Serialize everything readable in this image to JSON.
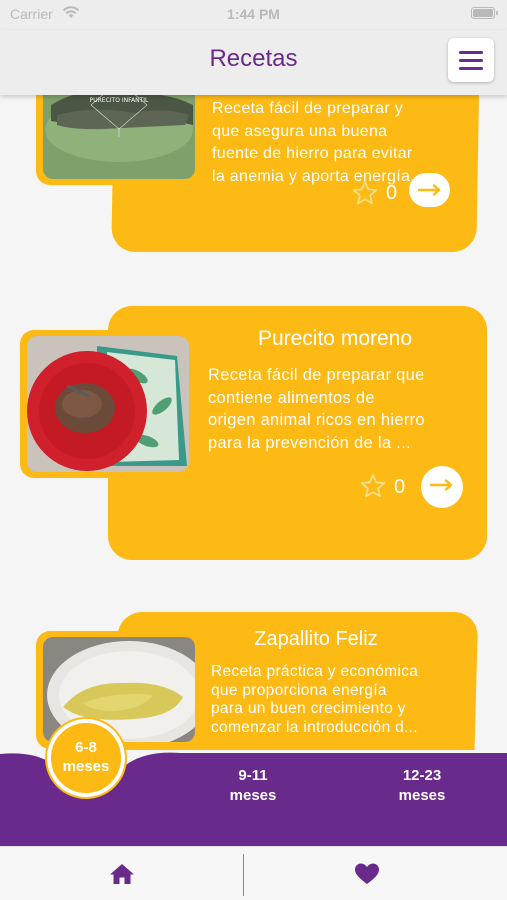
{
  "status_bar": {
    "carrier": "Carrier",
    "time": "1:44 PM",
    "icons": [
      "wifi-icon",
      "battery-icon"
    ]
  },
  "header": {
    "title": "Recetas",
    "menu_icon": "hamburger-menu-icon"
  },
  "recipes": [
    {
      "title": "",
      "description_lines": [
        "Receta fácil de preparar y",
        "que asegura una buena",
        "fuente de hierro para evitar",
        "la anemia  y aporta energía..."
      ],
      "likes": "0",
      "photo_icon": "green-puree-photo",
      "photo_watermark": "PURECITO INFANTIL"
    },
    {
      "title": "Purecito moreno",
      "description_lines": [
        "Receta fácil de preparar que",
        "contiene alimentos de",
        "origen animal ricos en hierro",
        "para la prevención de la ..."
      ],
      "likes": "0",
      "photo_icon": "brown-puree-red-plate-photo"
    },
    {
      "title": "Zapallito Feliz",
      "description_lines": [
        "Receta práctica y económica",
        "que proporciona energía",
        "para un buen crecimiento y",
        "comenzar la introducción d..."
      ],
      "likes": "0",
      "photo_icon": "squash-puree-plate-photo"
    }
  ],
  "age_tabs": [
    {
      "line1": "6-8",
      "line2": "meses",
      "selected": true
    },
    {
      "line1": "9-11",
      "line2": "meses",
      "selected": false
    },
    {
      "line1": "12-23",
      "line2": "meses",
      "selected": false
    }
  ],
  "tab_bar": {
    "items": [
      {
        "icon": "home-icon"
      },
      {
        "icon": "heart-icon"
      }
    ]
  },
  "colors": {
    "purple": "#6a2a8c",
    "amber": "#fdb914",
    "header_bg": "#ededed",
    "card_text": "#ffffff"
  }
}
